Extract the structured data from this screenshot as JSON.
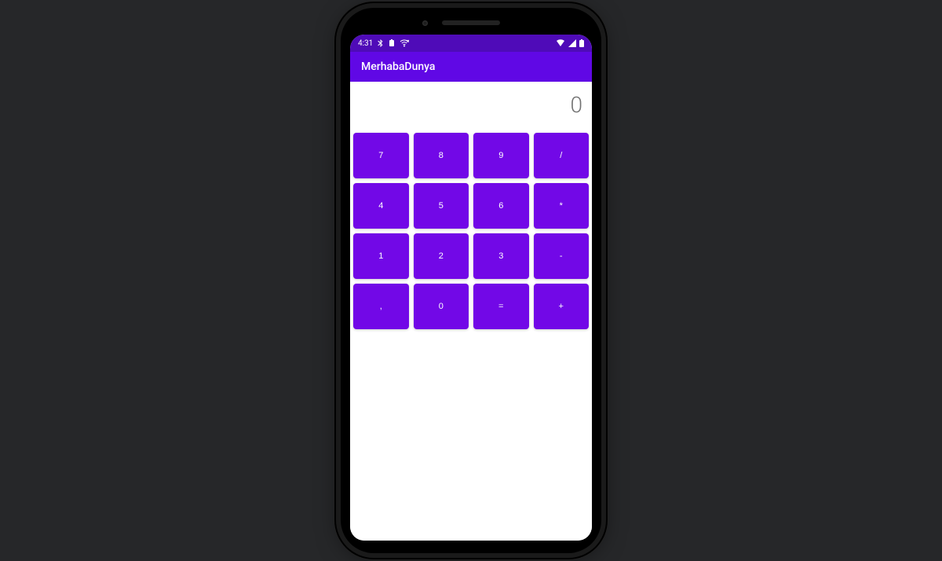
{
  "statusbar": {
    "time": "4:31"
  },
  "appbar": {
    "title": "MerhabaDunya"
  },
  "calculator": {
    "display_value": "0",
    "keys": [
      [
        "7",
        "8",
        "9",
        "/"
      ],
      [
        "4",
        "5",
        "6",
        "*"
      ],
      [
        "1",
        "2",
        "3",
        "-"
      ],
      [
        ",",
        "0",
        "=",
        "+"
      ]
    ]
  },
  "colors": {
    "statusbar_bg": "#4f0bb8",
    "appbar_bg": "#6008e5",
    "key_bg": "#7208e7"
  }
}
